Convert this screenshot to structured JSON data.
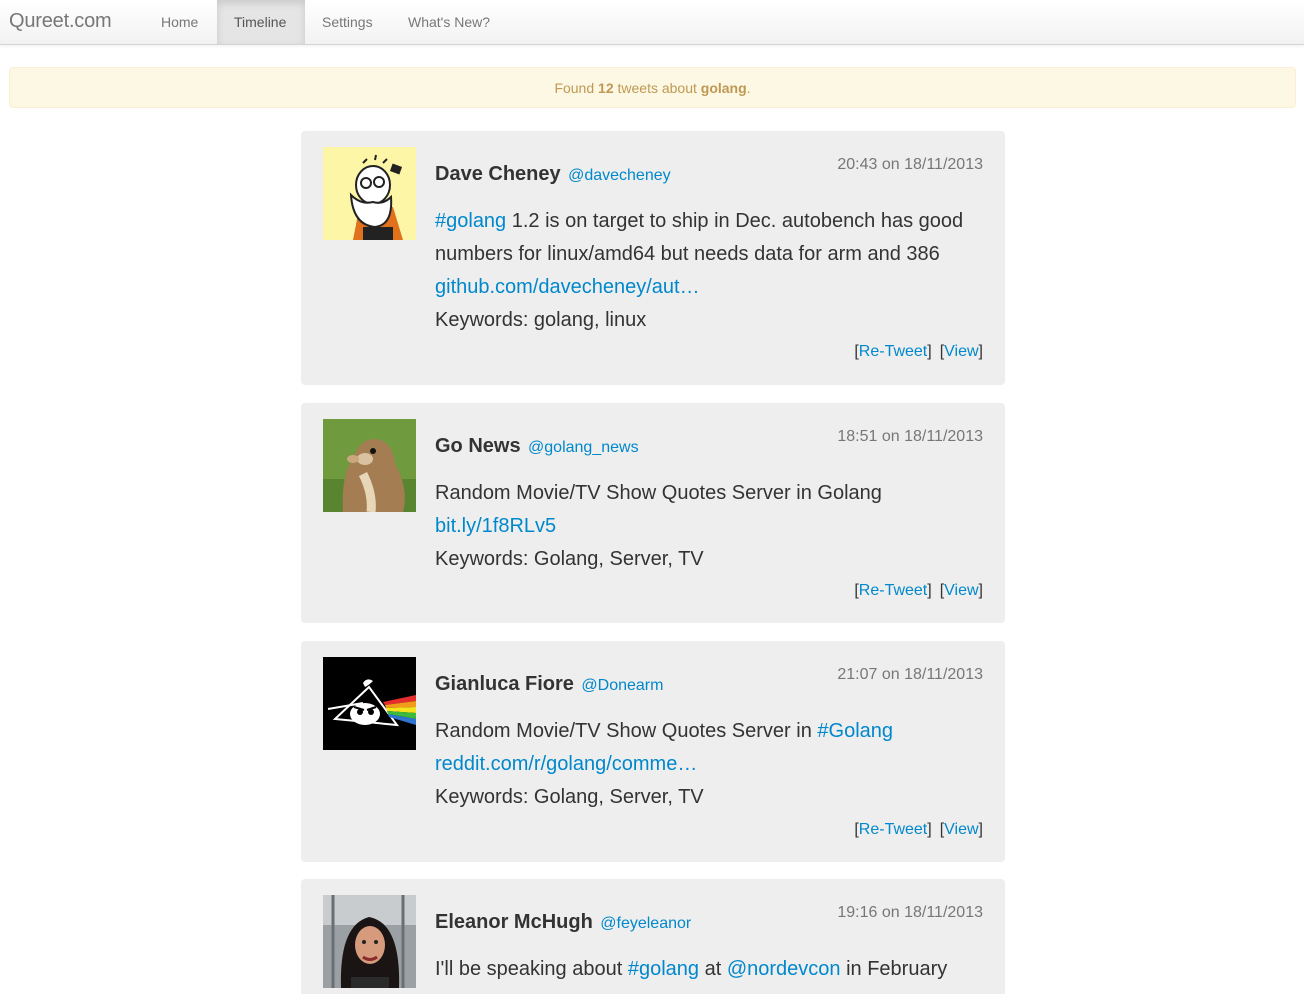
{
  "nav": {
    "brand": "Qureet.com",
    "items": [
      "Home",
      "Timeline",
      "Settings",
      "What's New?"
    ],
    "active": "Timeline"
  },
  "alert": {
    "prefix": "Found",
    "count": "12",
    "middle": "tweets about",
    "term": "golang",
    "suffix": "."
  },
  "actions": {
    "retweet": "Re-Tweet",
    "view": "View",
    "open_bracket": "[",
    "close_bracket": "]"
  },
  "tweets": [
    {
      "name": "Dave Cheney",
      "handle": "@davecheney",
      "time": "20:43 on 18/11/2013",
      "line1_tag": "#golang",
      "line1_rest": " 1.2 is on target to ship in Dec. autobench has good",
      "line2": "numbers for linux/amd64 but needs data for arm and 386",
      "link": "github.com/davecheney/aut…",
      "keywords": "Keywords: golang, linux"
    },
    {
      "name": "Go News",
      "handle": "@golang_news",
      "time": "18:51 on 18/11/2013",
      "line1": "Random Movie/TV Show Quotes Server in Golang",
      "link": "bit.ly/1f8RLv5",
      "keywords": "Keywords: Golang, Server, TV"
    },
    {
      "name": "Gianluca Fiore",
      "handle": "@Donearm",
      "time": "21:07 on 18/11/2013",
      "line1_text": "Random Movie/TV Show Quotes Server in ",
      "line1_tag": "#Golang",
      "link": "reddit.com/r/golang/comme…",
      "keywords": "Keywords: Golang, Server, TV"
    },
    {
      "name": "Eleanor McHugh",
      "handle": "@feyeleanor",
      "time": "19:16 on 18/11/2013",
      "p1": "I'll be speaking about ",
      "tag": "#golang",
      "p2": " at ",
      "mention": "@nordevcon",
      "p3": " in February"
    }
  ]
}
